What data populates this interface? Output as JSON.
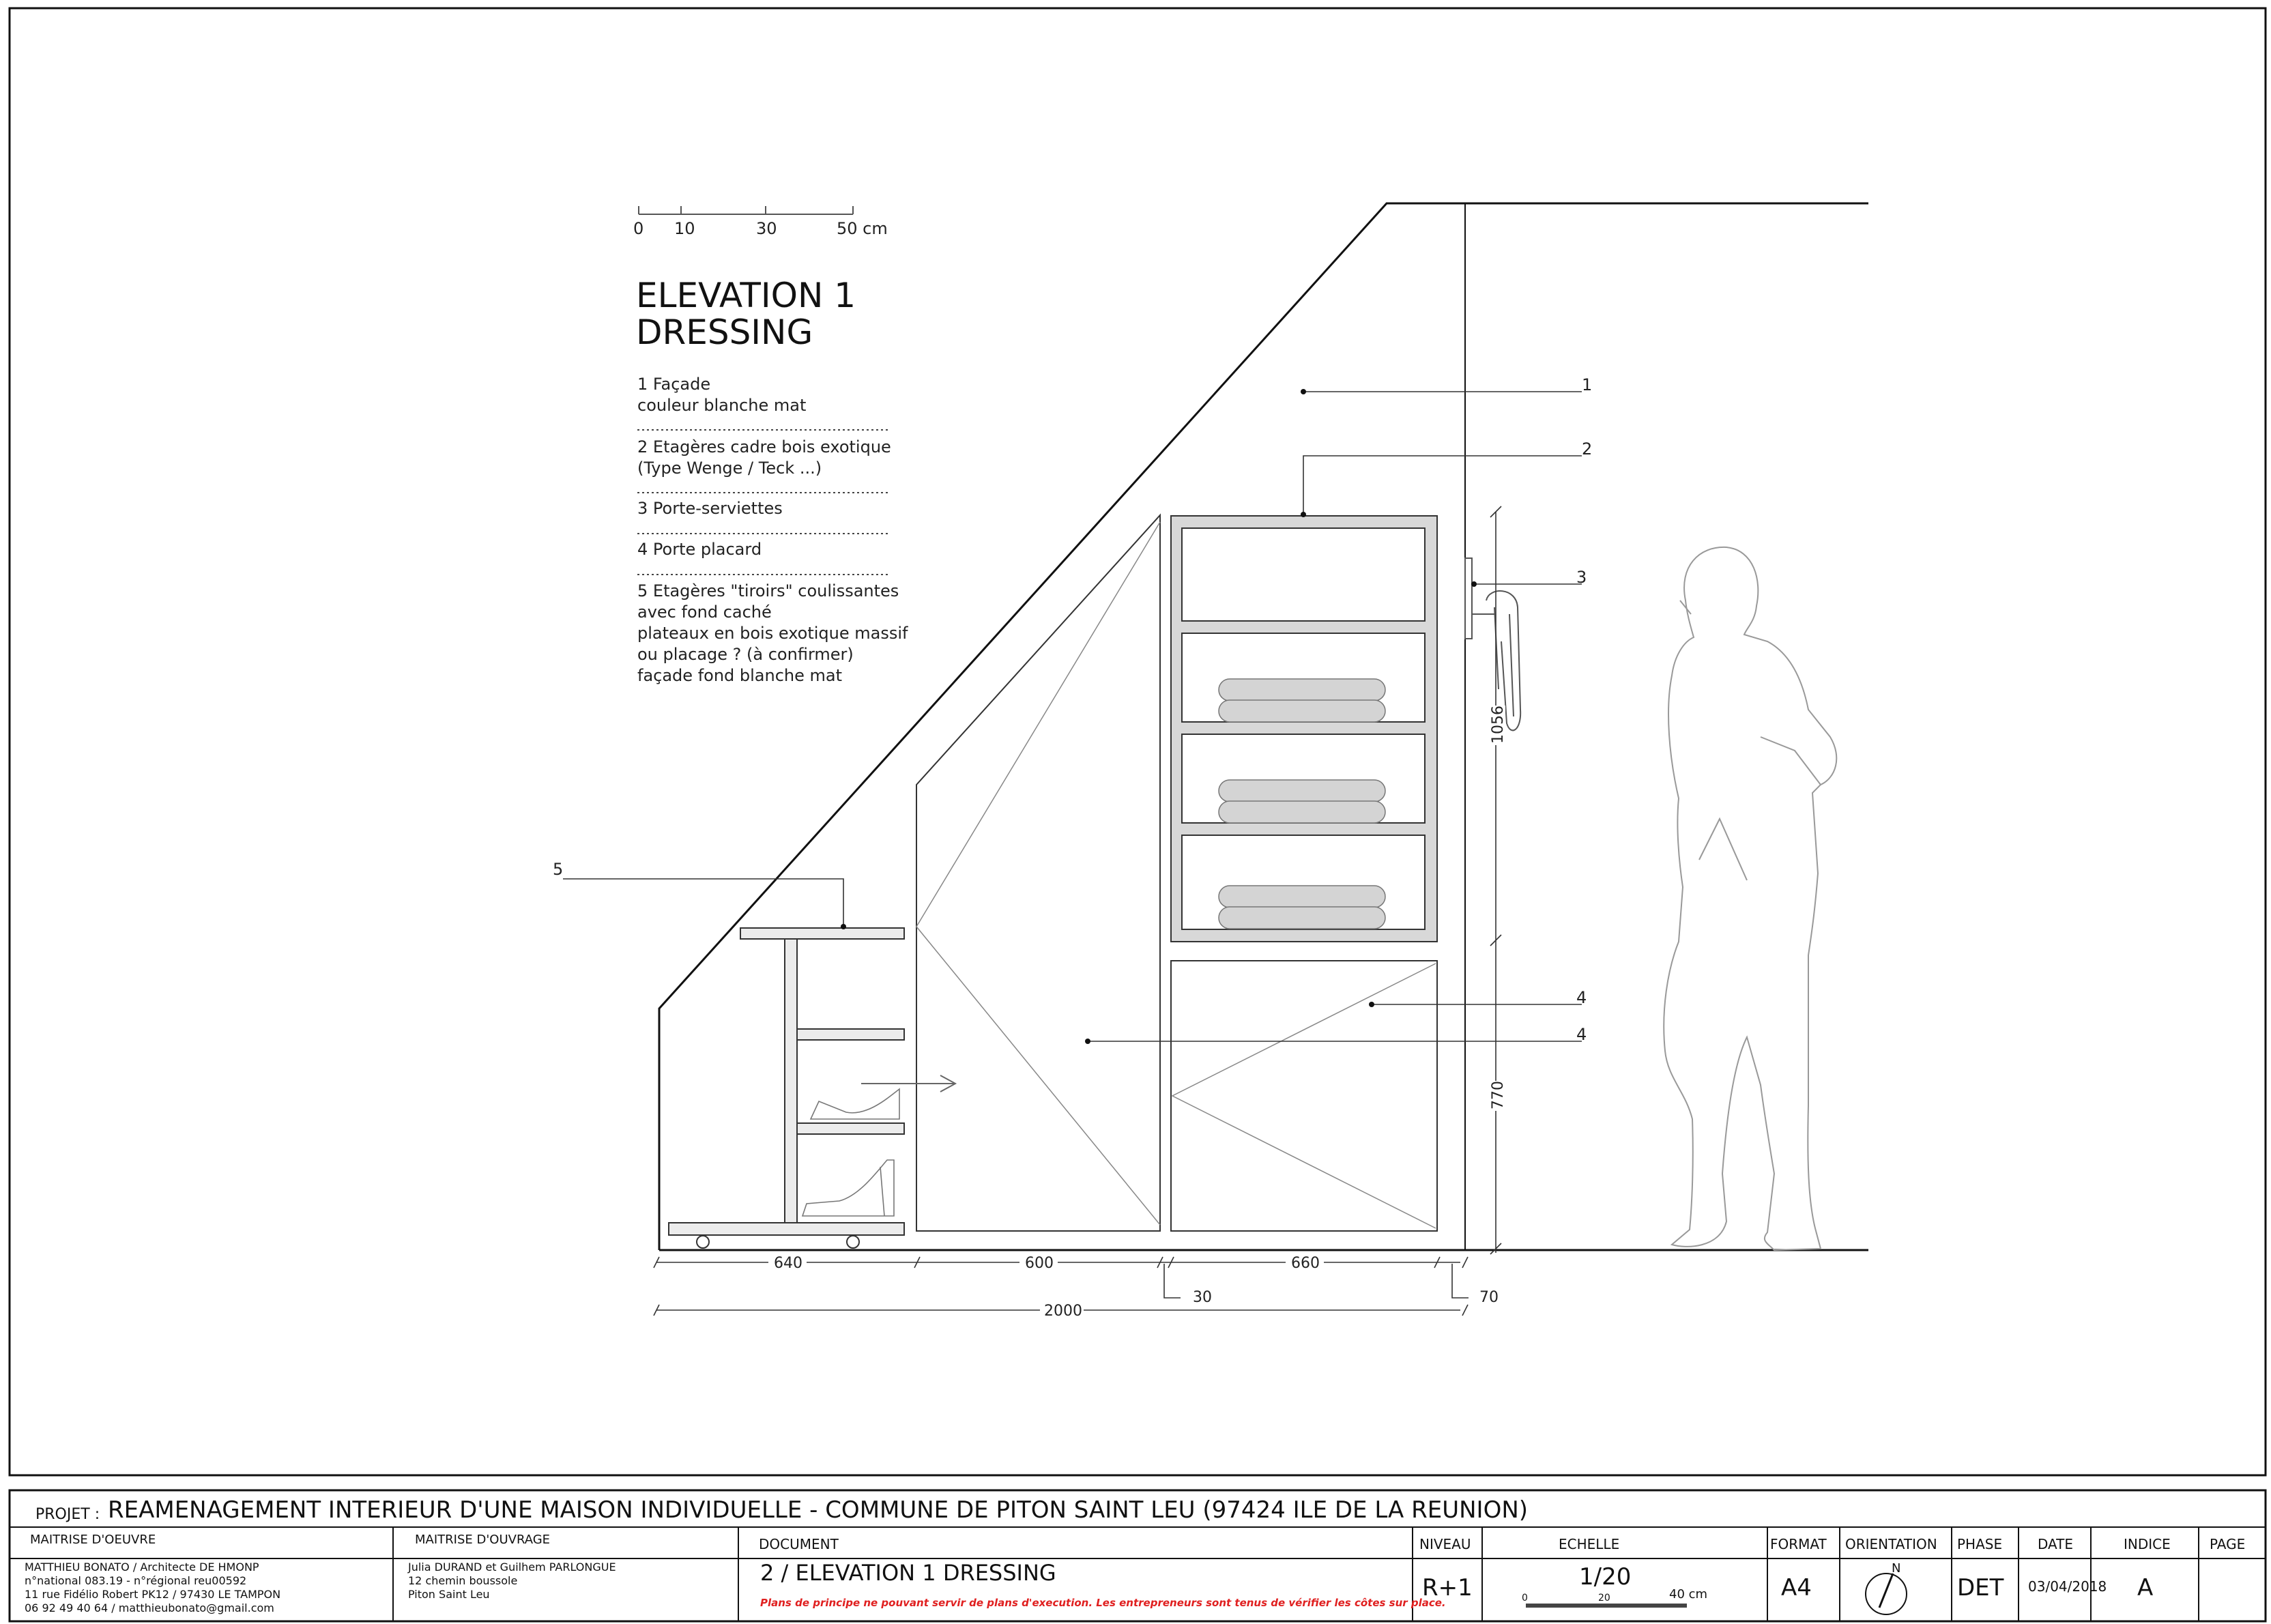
{
  "scale_bar": {
    "ticks": [
      "0",
      "10",
      "30",
      "50 cm"
    ]
  },
  "title": {
    "line1": "ELEVATION 1",
    "line2": "DRESSING"
  },
  "legend": [
    {
      "lines": [
        "1 Façade",
        "couleur blanche mat"
      ]
    },
    {
      "lines": [
        "2 Etagères cadre bois exotique",
        "(Type Wenge / Teck ...)"
      ]
    },
    {
      "lines": [
        "3 Porte-serviettes"
      ]
    },
    {
      "lines": [
        "4 Porte placard"
      ]
    },
    {
      "lines": [
        "5 Etagères \"tiroirs\" coulissantes",
        "avec fond caché",
        "plateaux en bois exotique massif",
        "ou placage ? (à confirmer)",
        "façade fond blanche mat"
      ]
    }
  ],
  "callouts": {
    "c1": "1",
    "c2": "2",
    "c3": "3",
    "c4a": "4",
    "c4b": "4",
    "c5": "5"
  },
  "dimensions": {
    "d640": "640",
    "d600": "600",
    "d660": "660",
    "d30": "30",
    "d70": "70",
    "d2000": "2000",
    "d1056": "1056",
    "d770": "770"
  },
  "title_block": {
    "projet_label": "PROJET :",
    "projet": "REAMENAGEMENT INTERIEUR D'UNE MAISON INDIVIDUELLE - COMMUNE DE PITON SAINT LEU (97424 ILE DE LA REUNION)",
    "moe_label": "MAITRISE D'OEUVRE",
    "moe_lines": [
      "MATTHIEU BONATO / Architecte DE HMONP",
      "n°national 083.19 - n°régional reu00592",
      "11 rue Fidélio Robert PK12 / 97430 LE TAMPON",
      "06 92 49 40 64 / matthieubonato@gmail.com"
    ],
    "mo_label": "MAITRISE D'OUVRAGE",
    "mo_lines": [
      "Julia DURAND et Guilhem PARLONGUE",
      "12 chemin boussole",
      "Piton Saint Leu"
    ],
    "document_label": "DOCUMENT",
    "document": "2 / ELEVATION 1 DRESSING",
    "disclaimer": "Plans de principe ne pouvant servir de plans d'execution. Les entrepreneurs sont tenus de vérifier les côtes sur place.",
    "disclaimer_color": "#e02020",
    "niveau_label": "NIVEAU",
    "niveau": "R+1",
    "echelle_label": "ECHELLE",
    "echelle": "1/20",
    "echelle_ticks": [
      "0",
      "20",
      "40 cm"
    ],
    "format_label": "FORMAT",
    "format": "A4",
    "orientation_label": "ORIENTATION",
    "north": "N",
    "phase_label": "PHASE",
    "phase": "DET",
    "date_label": "DATE",
    "date": "03/04/2018",
    "indice_label": "INDICE",
    "indice": "A",
    "page_label": "PAGE",
    "page": ""
  }
}
